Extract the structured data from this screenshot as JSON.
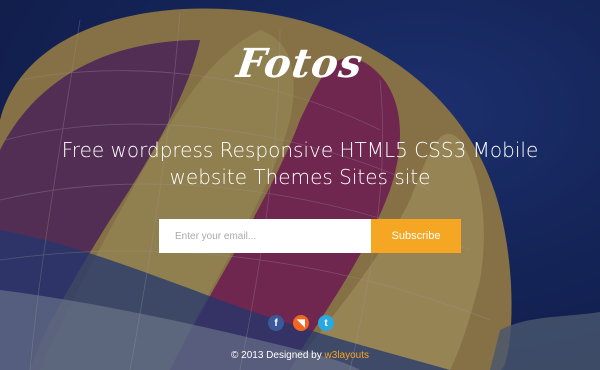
{
  "brand": {
    "logo_text": "Fotos"
  },
  "hero": {
    "tagline": "Free wordpress Responsive HTML5 CSS3 Mobile website Themes Sites site"
  },
  "subscribe": {
    "email_placeholder": "Enter your email...",
    "button_label": "Subscribe"
  },
  "social": [
    {
      "name": "facebook-icon",
      "glyph": "f",
      "color": "#3b5998"
    },
    {
      "name": "rss-icon",
      "glyph": "◥",
      "color": "#f26522"
    },
    {
      "name": "twitter-icon",
      "glyph": "t",
      "color": "#2aa9e0"
    }
  ],
  "footer": {
    "copyright": "© 2013 Designed by ",
    "link_text": "w3layouts"
  },
  "colors": {
    "accent": "#f5a623",
    "background": "#1a2a5c"
  }
}
